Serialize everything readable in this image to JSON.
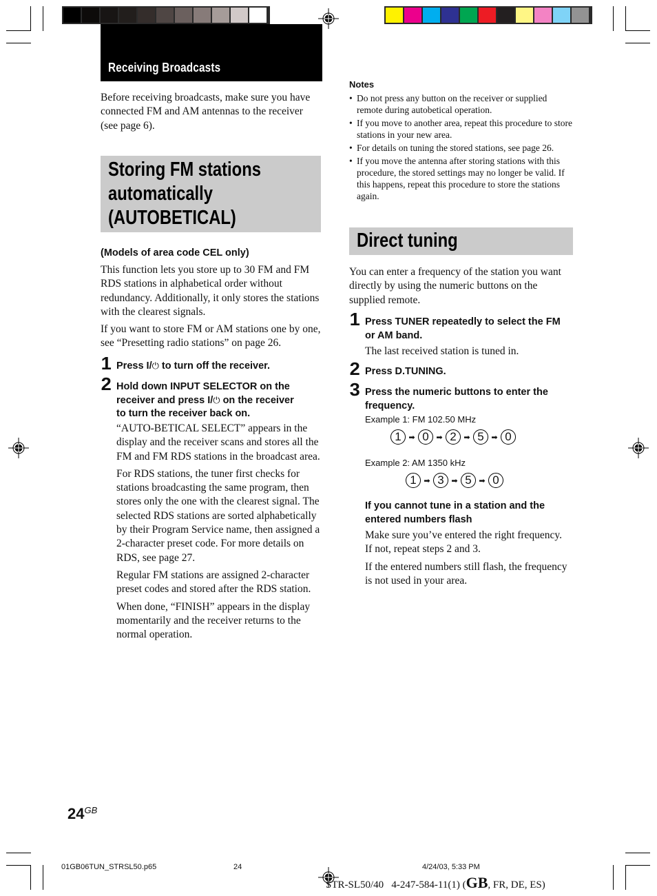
{
  "print_marks": {
    "gray_bar": [
      "#000000",
      "#0d0b0a",
      "#181514",
      "#221e1c",
      "#342d2b",
      "#4f4644",
      "#6b605e",
      "#877b79",
      "#a69c99",
      "#d1c9c8",
      "#ffffff"
    ],
    "color_bar": [
      "#fff200",
      "#ec008c",
      "#00aeef",
      "#2e3192",
      "#00a651",
      "#ed1c24",
      "#231f20",
      "#fff685",
      "#f383c4",
      "#7fd3f7",
      "#939393"
    ]
  },
  "header": {
    "section_title": "Receiving Broadcasts"
  },
  "left": {
    "intro": "Before receiving broadcasts, make sure you have connected FM and AM antennas to the receiver (see page 6).",
    "heading_lines": [
      "Storing FM stations",
      "automatically",
      "(AUTOBETICAL)"
    ],
    "subhead": "(Models of area code CEL only)",
    "paragraphs": [
      "This function lets you store up to 30 FM and FM RDS stations in alphabetical order without redundancy. Additionally, it only stores the stations with the clearest signals.",
      "If you want to store FM or AM stations one by one, see “Presetting radio stations” on page 26."
    ],
    "steps": [
      {
        "num": "1",
        "pre": "Press I/",
        "post": " to turn off the receiver."
      },
      {
        "num": "2",
        "line1": "Hold down INPUT SELECTOR on the",
        "line2_pre": "receiver and press I/",
        "line2_post": " on the receiver",
        "line3": "to turn the receiver back on."
      }
    ],
    "power_symbol": "⏻",
    "step2_paragraphs": [
      "“AUTO-BETICAL SELECT” appears in the display and the receiver scans and stores all the FM and FM RDS stations in the broadcast area.",
      "For RDS stations, the tuner first checks for stations broadcasting the same program, then stores only the one with the clearest signal. The selected RDS stations are sorted alphabetically by their Program Service name, then assigned a 2-character preset code. For more details on RDS, see page 27.",
      "Regular FM stations are assigned 2-character preset codes and stored after the RDS station.",
      "When done, “FINISH” appears in the display momentarily and the receiver returns to the normal operation."
    ]
  },
  "right": {
    "notes_title": "Notes",
    "notes": [
      "Do not press any button on the receiver or supplied remote during autobetical operation.",
      "If you move to another area, repeat this procedure to store stations in your new area.",
      "For details on tuning the stored stations, see page 26.",
      "If you move the antenna after storing stations with this procedure, the stored settings may no longer be valid. If this happens, repeat this procedure to store the stations again."
    ],
    "heading": "Direct tuning",
    "intro": "You can enter a frequency of the station you want directly by using the numeric buttons on the supplied remote.",
    "steps": [
      {
        "num": "1",
        "text": "Press TUNER repeatedly to select the FM or AM band.",
        "detail": "The last received station is tuned in."
      },
      {
        "num": "2",
        "text": "Press D.TUNING."
      },
      {
        "num": "3",
        "text": "Press the numeric buttons to enter the frequency."
      }
    ],
    "example1_label": "Example 1:  FM 102.50 MHz",
    "example1_keys": [
      "1",
      "0",
      "2",
      "5",
      "0"
    ],
    "example2_label": "Example 2:  AM 1350 kHz",
    "example2_keys": [
      "1",
      "3",
      "5",
      "0"
    ],
    "arrow": "➡",
    "trouble_heading": "If you cannot tune in a station and the entered numbers flash",
    "trouble_paragraphs": [
      "Make sure you’ve entered the right frequency. If not, repeat steps 2 and 3.",
      "If the entered numbers still flash, the frequency is not used in your area."
    ]
  },
  "footer": {
    "page_number": "24",
    "page_suffix": "GB",
    "file_name": "01GB06TUN_STRSL50.p65",
    "slug_page": "24",
    "timestamp": "4/24/03, 5:33 PM",
    "model_pre": "STR-SL50/40   4-247-584-11(1) (",
    "model_gb": "GB",
    "model_post": ", FR, DE, ES)"
  }
}
